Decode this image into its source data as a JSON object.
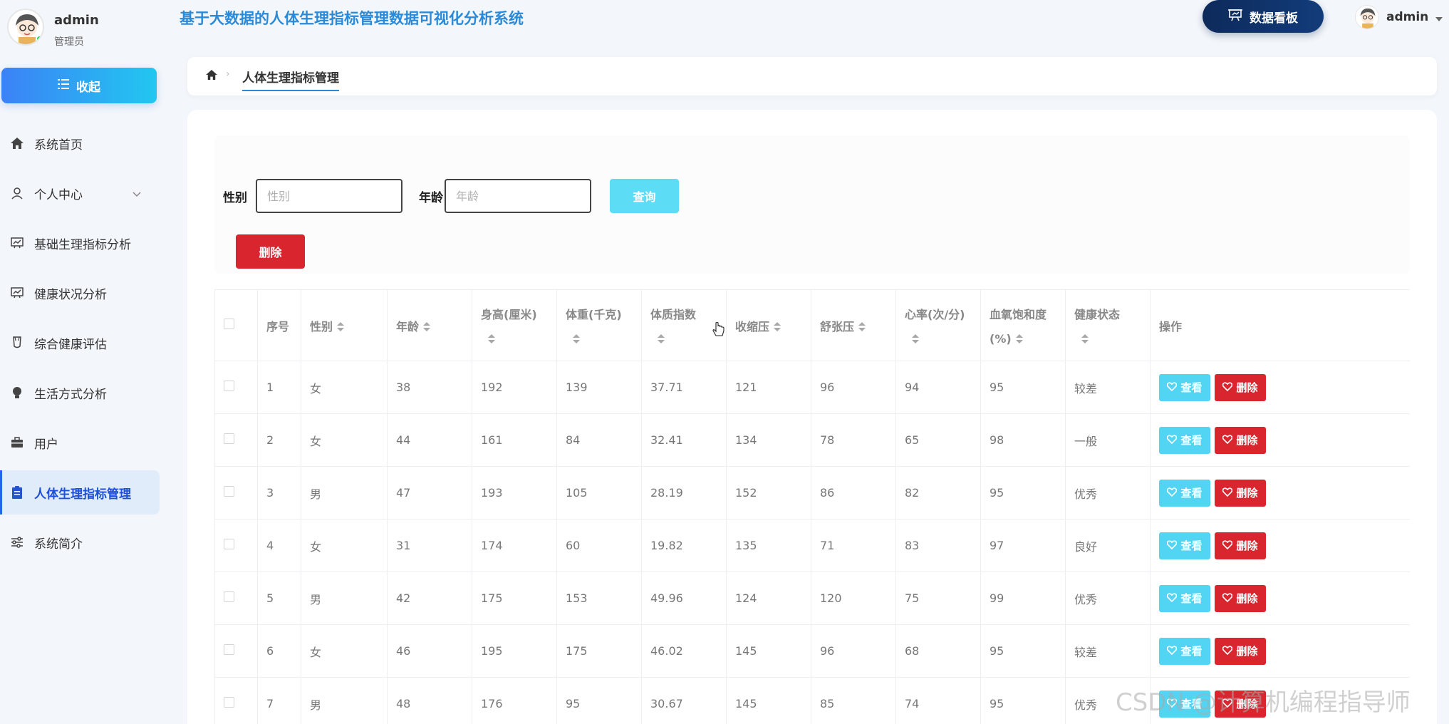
{
  "sidebar": {
    "user_name": "admin",
    "user_role": "管理员",
    "collapse_label": "收起",
    "items": [
      {
        "label": "系统首页",
        "icon": "home-icon"
      },
      {
        "label": "个人中心",
        "icon": "user-icon"
      },
      {
        "label": "基础生理指标分析",
        "icon": "chart-board-icon"
      },
      {
        "label": "健康状况分析",
        "icon": "chart-board-icon"
      },
      {
        "label": "综合健康评估",
        "icon": "cup-icon"
      },
      {
        "label": "生活方式分析",
        "icon": "bulb-icon"
      },
      {
        "label": "用户",
        "icon": "briefcase-icon"
      },
      {
        "label": "人体生理指标管理",
        "icon": "clipboard-icon"
      },
      {
        "label": "系统简介",
        "icon": "sliders-icon"
      }
    ]
  },
  "header": {
    "title": "基于大数据的人体生理指标管理数据可视化分析系统",
    "dashboard_label": "数据看板",
    "user_name": "admin"
  },
  "breadcrumb": {
    "current": "人体生理指标管理"
  },
  "filters": {
    "gender_label": "性别",
    "gender_placeholder": "性别",
    "age_label": "年龄",
    "age_placeholder": "年龄",
    "query_label": "查询",
    "delete_label": "删除"
  },
  "table": {
    "headers": {
      "index": "序号",
      "gender": "性别",
      "age": "年龄",
      "height": "身高(厘米)",
      "weight": "体重(千克)",
      "bmi": "体质指数",
      "systolic": "收缩压",
      "diastolic": "舒张压",
      "heart_rate": "心率(次/分)",
      "spo2_line1": "血氧饱和度",
      "spo2_line2": "(%)",
      "health": "健康状态",
      "actions": "操作"
    },
    "view_label": "查看",
    "delete_label": "删除",
    "rows": [
      [
        "1",
        "女",
        "38",
        "192",
        "139",
        "37.71",
        "121",
        "96",
        "94",
        "95",
        "较差"
      ],
      [
        "2",
        "女",
        "44",
        "161",
        "84",
        "32.41",
        "134",
        "78",
        "65",
        "98",
        "一般"
      ],
      [
        "3",
        "男",
        "47",
        "193",
        "105",
        "28.19",
        "152",
        "86",
        "82",
        "95",
        "优秀"
      ],
      [
        "4",
        "女",
        "31",
        "174",
        "60",
        "19.82",
        "135",
        "71",
        "83",
        "97",
        "良好"
      ],
      [
        "5",
        "男",
        "42",
        "175",
        "153",
        "49.96",
        "124",
        "120",
        "75",
        "99",
        "优秀"
      ],
      [
        "6",
        "女",
        "46",
        "195",
        "175",
        "46.02",
        "145",
        "96",
        "68",
        "95",
        "较差"
      ],
      [
        "7",
        "男",
        "48",
        "176",
        "95",
        "30.67",
        "145",
        "85",
        "74",
        "95",
        "优秀"
      ]
    ]
  },
  "watermark": "CSDN @计算机编程指导师"
}
